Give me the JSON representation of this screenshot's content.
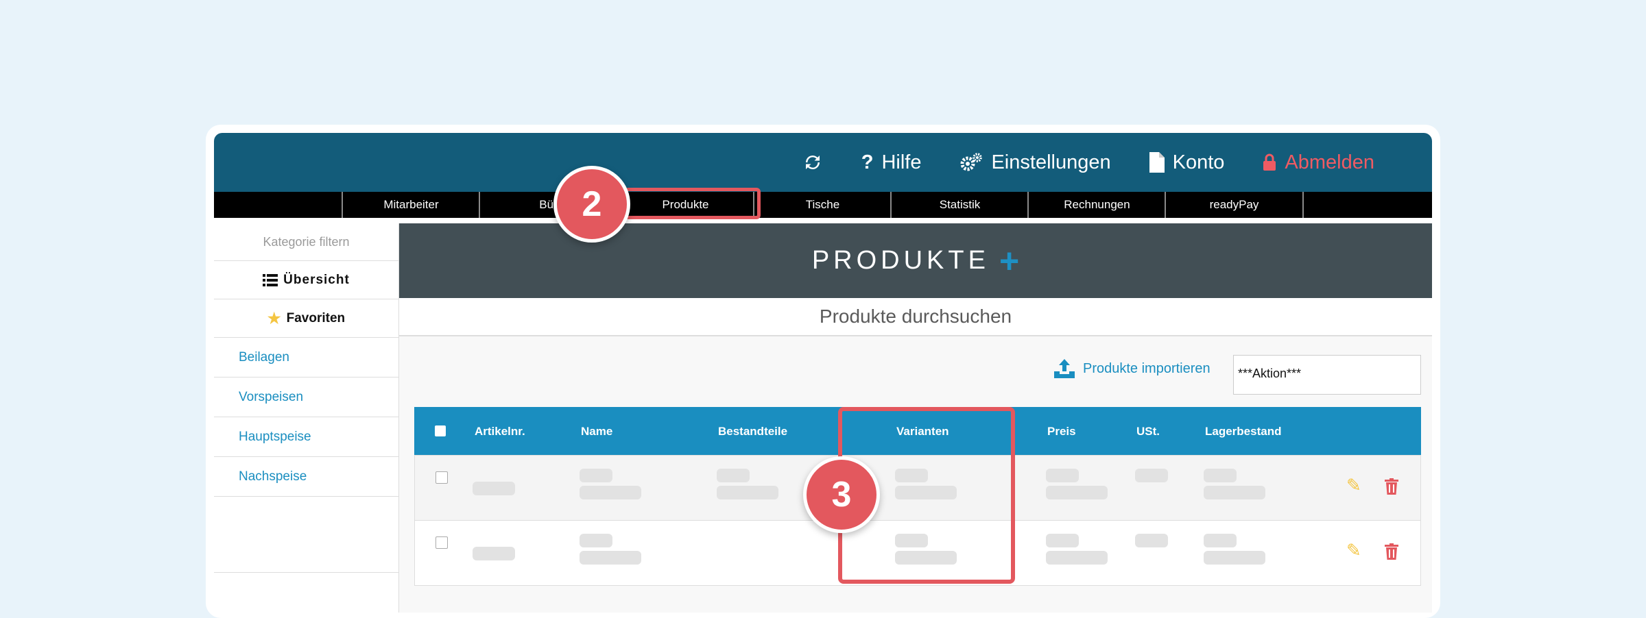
{
  "header": {
    "nav": [
      {
        "icon": "refresh-icon",
        "label": ""
      },
      {
        "icon": "help-icon",
        "label": "Hilfe"
      },
      {
        "icon": "gears-icon",
        "label": "Einstellungen"
      },
      {
        "icon": "file-icon",
        "label": "Konto"
      },
      {
        "icon": "lock-icon",
        "label": "Abmelden"
      }
    ],
    "help_glyph": "?",
    "colors": {
      "topbar": "#135c7a",
      "logout": "#ef5b63",
      "accent": "#1a8ec0",
      "highlight": "#e3585e"
    }
  },
  "tabs": [
    "Mitarbeiter",
    "Bür",
    "Produkte",
    "Tische",
    "Statistik",
    "Rechnungen",
    "readyPay"
  ],
  "badges": {
    "tab": "2",
    "column": "3"
  },
  "sidebar": {
    "filter": "Kategorie filtern",
    "overview": "Übersicht",
    "favorites": "Favoriten",
    "categories": [
      "Beilagen",
      "Vorspeisen",
      "Hauptspeise",
      "Nachspeise"
    ]
  },
  "main": {
    "title": "PRODUKTE",
    "plus": "+",
    "search_title": "Produkte durchsuchen",
    "import_label": "Produkte importieren",
    "action_select": "***Aktion***",
    "columns": [
      "Artikelnr.",
      "Name",
      "Bestandteile",
      "Varianten",
      "Preis",
      "USt.",
      "Lagerbestand"
    ]
  }
}
